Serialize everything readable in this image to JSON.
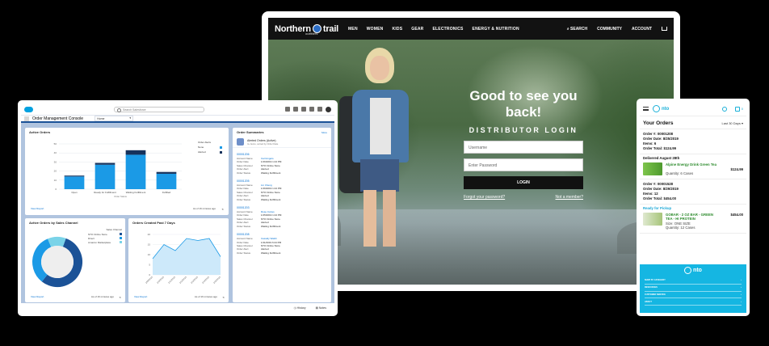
{
  "store": {
    "logo_text": "Northern",
    "logo_text2": "trail",
    "logo_sub": "outfitters",
    "nav": [
      "MEN",
      "WOMEN",
      "KIDS",
      "GEAR",
      "ELECTRONICS",
      "ENERGY & NUTRITION"
    ],
    "nav_right": {
      "search": "SEARCH",
      "community": "COMMUNITY",
      "account": "ACCOUNT"
    },
    "login": {
      "title": "Good to see you back!",
      "subtitle": "DISTRIBUTOR LOGIN",
      "username_placeholder": "Username",
      "password_placeholder": "Enter Password",
      "button": "LOGIN",
      "forgot": "Forgot your password?",
      "member": "Not a member?"
    }
  },
  "console": {
    "search_placeholder": "Search Salesforce",
    "app_name": "Order Management Console",
    "tab": "Home",
    "active_orders": {
      "title": "Active Orders",
      "legend_title": "Order Alerts",
      "legend": [
        "None",
        "Alerted"
      ],
      "view_report": "View Report",
      "timestamp": "As of 16 minutes ago",
      "axis_title": "Order Status"
    },
    "by_channel": {
      "title": "Active Orders by Sales Channel",
      "legend_title": "Sales Channel",
      "legend": [
        "NTO Online Store",
        "Direct",
        "Amazon Marketplace"
      ],
      "view_report": "View Report",
      "timestamp": "As of 16 minutes ago"
    },
    "created": {
      "title": "Orders Created Past 7 Days",
      "view_report": "View Report",
      "timestamp": "As of 16 minutes ago"
    },
    "summaries": {
      "title": "Order Summaries",
      "more": "More",
      "list_title": "Alerted Orders (Active)",
      "list_sub": "4+ items, sorted by Order Date",
      "labels": [
        "Account Name",
        "Order Date",
        "Sales Channel",
        "Order Alert",
        "Order Status"
      ],
      "orders": [
        {
          "num": "00001206",
          "account": "Carl Angelo",
          "date": "1/16/2019 1:24 PM",
          "channel": "NTO Online Store",
          "alert": "Alerted",
          "status": "Waiting Fulfillment"
        },
        {
          "num": "00001205",
          "account": "Lin Cheng",
          "date": "1/16/2019 1:24 PM",
          "channel": "NTO Online Store",
          "alert": "Alerted",
          "status": "Waiting Fulfillment"
        },
        {
          "num": "00001203",
          "account": "Rose Cortes",
          "date": "1/15/2019 1:24 PM",
          "channel": "NTO Online Store",
          "alert": "Alerted",
          "status": "Waiting Fulfillment"
        },
        {
          "num": "00001208",
          "account": "Cassidy Walsh",
          "date": "1/11/2019 6:24 PM",
          "channel": "NTO Online Store",
          "alert": "Alerted",
          "status": "Waiting Fulfillment"
        }
      ]
    },
    "footer": {
      "history": "History",
      "notes": "Notes"
    }
  },
  "chart_data": [
    {
      "type": "bar",
      "title": "Active Orders",
      "xlabel": "Order Status",
      "categories": [
        "Open",
        "Ready for Fulfillment",
        "Waiting Fulfillment",
        "Fulfilled"
      ],
      "series": [
        {
          "name": "None",
          "values": [
            14,
            27,
            38,
            17
          ]
        },
        {
          "name": "Alerted",
          "values": [
            1,
            2,
            5,
            2
          ]
        }
      ],
      "ylim": [
        0,
        50
      ],
      "yticks": [
        0,
        10,
        20,
        30,
        40,
        50
      ]
    },
    {
      "type": "pie",
      "title": "Active Orders by Sales Channel",
      "categories": [
        "NTO Online Store",
        "Direct",
        "Amazon Marketplace"
      ],
      "values": [
        55,
        33,
        12
      ]
    },
    {
      "type": "area",
      "title": "Orders Created Past 7 Days",
      "x": [
        "1/09/2019",
        "1/10/2019",
        "1/11/2019",
        "1/12/2019",
        "1/13/2019",
        "1/14/2019",
        "1/15/2019"
      ],
      "values": [
        8,
        15,
        12,
        18,
        17,
        18,
        9
      ],
      "ylim": [
        0,
        20
      ],
      "yticks": [
        0,
        5,
        10,
        15,
        20
      ]
    }
  ],
  "mobile": {
    "brand": "nto",
    "cart_count": "0",
    "orders_title": "Your Orders",
    "filter": "Last 30 Days",
    "orders": [
      {
        "lines": [
          "Order #: 00001208",
          "Order Date: 8/25/2019",
          "Items: 6",
          "Order Total: $124.99"
        ],
        "status": "Delivered August 28th",
        "product": "Alpine Energy Drink Green Tea",
        "price": "$124.99",
        "qty": "Quantity: 6 Cases"
      },
      {
        "lines": [
          "Order #: 00001528",
          "Order Date: 8/29/2019",
          "Items: 12",
          "Order Total: $454.00"
        ],
        "status": "Ready for Pickup",
        "product": "GOBAR - 2 OZ BAR - GREEN TEA - HI PROTEIN",
        "price": "$454.00",
        "size": "Size: ONE SIZE",
        "qty": "Quantity: 12 Cases"
      }
    ],
    "footer_items": [
      "SHOP BY CATEGORY",
      "RESOURCES",
      "CUSTOMER SERVICE",
      "ABOUT"
    ],
    "colors": {
      "accent": "#15b6e2",
      "green": "#2b8a2b"
    }
  },
  "colors": {
    "bar_dark": "#16325c",
    "bar_light": "#1b9ae6",
    "pie": [
      "#1b5297",
      "#1b9ae6",
      "#7ad3e8"
    ]
  }
}
